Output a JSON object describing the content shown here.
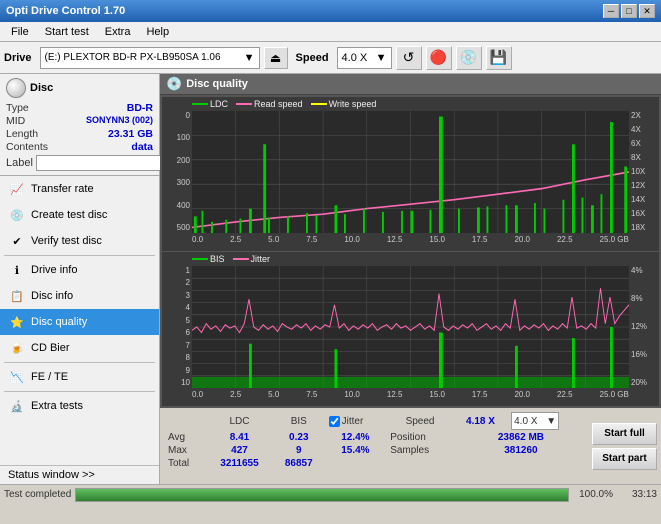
{
  "app": {
    "title": "Opti Drive Control 1.70",
    "title_icon": "💿"
  },
  "title_bar": {
    "minimize": "─",
    "maximize": "□",
    "close": "✕"
  },
  "menu": {
    "items": [
      "File",
      "Start test",
      "Extra",
      "Help"
    ]
  },
  "toolbar": {
    "drive_label": "Drive",
    "drive_value": "(E:)  PLEXTOR BD-R  PX-LB950SA 1.06",
    "speed_label": "Speed",
    "speed_value": "4.0 X",
    "eject_icon": "⏏"
  },
  "disc": {
    "header": "Disc",
    "type_label": "Type",
    "type_value": "BD-R",
    "mid_label": "MID",
    "mid_value": "SONYNN3 (002)",
    "length_label": "Length",
    "length_value": "23.31 GB",
    "contents_label": "Contents",
    "contents_value": "data",
    "label_label": "Label",
    "label_value": "",
    "label_placeholder": ""
  },
  "nav": {
    "items": [
      {
        "id": "transfer-rate",
        "label": "Transfer rate",
        "icon": "📈"
      },
      {
        "id": "create-test-disc",
        "label": "Create test disc",
        "icon": "💿"
      },
      {
        "id": "verify-test-disc",
        "label": "Verify test disc",
        "icon": "✔"
      },
      {
        "id": "drive-info",
        "label": "Drive info",
        "icon": "ℹ"
      },
      {
        "id": "disc-info",
        "label": "Disc info",
        "icon": "📋"
      },
      {
        "id": "disc-quality",
        "label": "Disc quality",
        "icon": "⭐",
        "active": true
      },
      {
        "id": "cd-bier",
        "label": "CD Bier",
        "icon": "🍺"
      },
      {
        "id": "fe-te",
        "label": "FE / TE",
        "icon": "📉"
      },
      {
        "id": "extra-tests",
        "label": "Extra tests",
        "icon": "🔬"
      }
    ],
    "status_window": "Status window >>"
  },
  "disc_quality": {
    "title": "Disc quality"
  },
  "chart1": {
    "legend": [
      {
        "label": "LDC",
        "color": "#00cc00"
      },
      {
        "label": "Read speed",
        "color": "#ff69b4"
      },
      {
        "label": "Write speed",
        "color": "#ffff00"
      }
    ],
    "y_left": [
      "500",
      "400",
      "300",
      "200",
      "100",
      "0"
    ],
    "y_right": [
      "18X",
      "16X",
      "14X",
      "12X",
      "10X",
      "8X",
      "6X",
      "4X",
      "2X"
    ],
    "x_labels": [
      "0.0",
      "2.5",
      "5.0",
      "7.5",
      "10.0",
      "12.5",
      "15.0",
      "17.5",
      "20.0",
      "22.5",
      "25.0 GB"
    ]
  },
  "chart2": {
    "legend": [
      {
        "label": "BIS",
        "color": "#00cc00"
      },
      {
        "label": "Jitter",
        "color": "#ff69b4"
      }
    ],
    "y_left": [
      "10",
      "9",
      "8",
      "7",
      "6",
      "5",
      "4",
      "3",
      "2",
      "1"
    ],
    "y_right": [
      "20%",
      "16%",
      "12%",
      "8%",
      "4%"
    ],
    "x_labels": [
      "0.0",
      "2.5",
      "5.0",
      "7.5",
      "10.0",
      "12.5",
      "15.0",
      "17.5",
      "20.0",
      "22.5",
      "25.0 GB"
    ]
  },
  "stats": {
    "headers": [
      "",
      "LDC",
      "BIS",
      "",
      "Jitter",
      "Speed",
      ""
    ],
    "avg_label": "Avg",
    "avg_ldc": "8.41",
    "avg_bis": "0.23",
    "avg_jitter": "12.4%",
    "max_label": "Max",
    "max_ldc": "427",
    "max_bis": "9",
    "max_jitter": "15.4%",
    "total_label": "Total",
    "total_ldc": "3211655",
    "total_bis": "86857",
    "position_label": "Position",
    "position_value": "23862 MB",
    "samples_label": "Samples",
    "samples_value": "381260",
    "speed_label": "Speed",
    "speed_value": "4.18 X",
    "speed_select": "4.0 X",
    "jitter_checked": true,
    "start_full": "Start full",
    "start_part": "Start part"
  },
  "status_bar": {
    "text": "Test completed",
    "progress": 100,
    "progress_text": "100.0%",
    "time": "33:13"
  }
}
